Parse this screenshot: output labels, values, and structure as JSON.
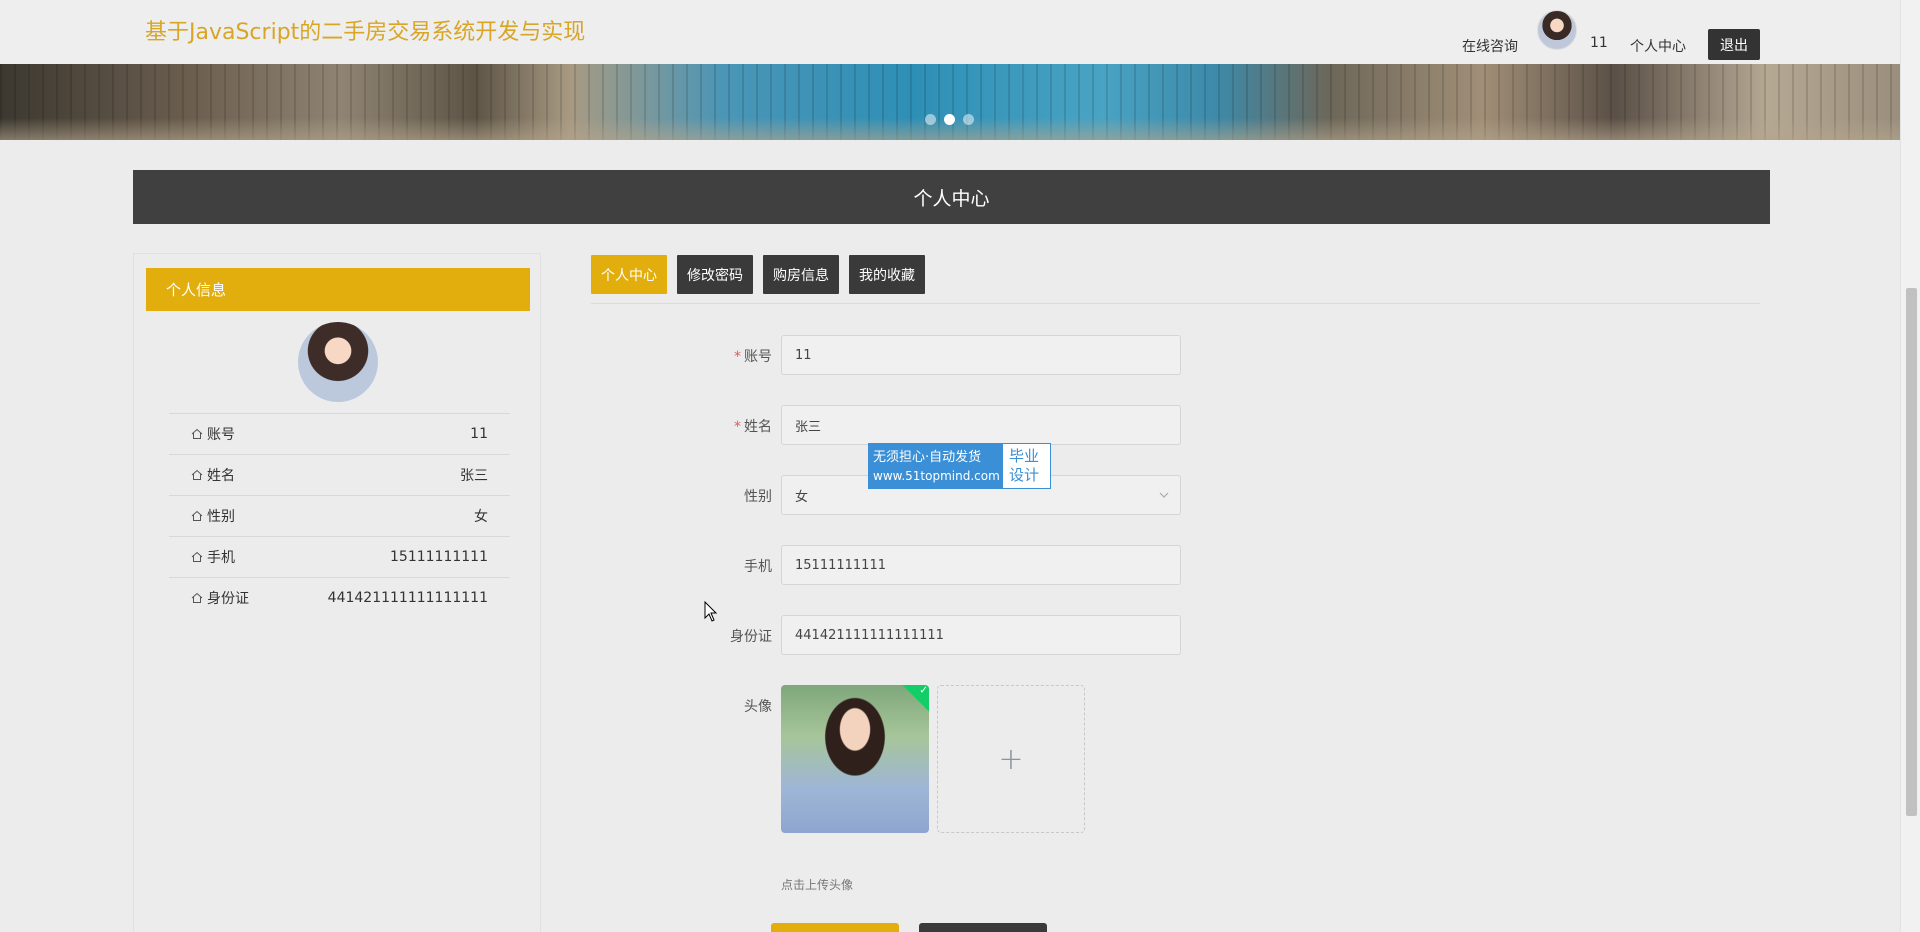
{
  "header": {
    "site_title": "基于JavaScript的二手房交易系统开发与实现",
    "consult_label": "在线咨询",
    "username": "11",
    "center_label": "个人中心",
    "logout_label": "退出"
  },
  "banner": {
    "slide_count": 3,
    "active_slide": 2
  },
  "section": {
    "title": "个人中心"
  },
  "sidebar": {
    "header": "个人信息",
    "rows": [
      {
        "label": "账号",
        "value": "11",
        "icon": "home-icon"
      },
      {
        "label": "姓名",
        "value": "张三",
        "icon": "home-icon"
      },
      {
        "label": "性别",
        "value": "女",
        "icon": "home-icon"
      },
      {
        "label": "手机",
        "value": "15111111111",
        "icon": "home-icon"
      },
      {
        "label": "身份证",
        "value": "441421111111111111",
        "icon": "home-icon"
      }
    ]
  },
  "tabs": [
    {
      "label": "个人中心",
      "active": true
    },
    {
      "label": "修改密码",
      "active": false
    },
    {
      "label": "购房信息",
      "active": false
    },
    {
      "label": "我的收藏",
      "active": false
    }
  ],
  "form": {
    "account": {
      "label": "账号",
      "value": "11",
      "required": true
    },
    "name": {
      "label": "姓名",
      "value": "张三",
      "required": true
    },
    "gender": {
      "label": "性别",
      "value": "女"
    },
    "phone": {
      "label": "手机",
      "value": "15111111111"
    },
    "id_card": {
      "label": "身份证",
      "value": "441421111111111111"
    },
    "avatar": {
      "label": "头像",
      "hint": "点击上传头像"
    },
    "required_mark": "*"
  },
  "watermark": {
    "line1": "无须担心·自动发货",
    "line2": "www.51topmind.com",
    "right1": "毕业",
    "right2": "设计"
  },
  "colors": {
    "accent": "#e2ae0e",
    "dark": "#404040",
    "title": "#d9a524"
  }
}
